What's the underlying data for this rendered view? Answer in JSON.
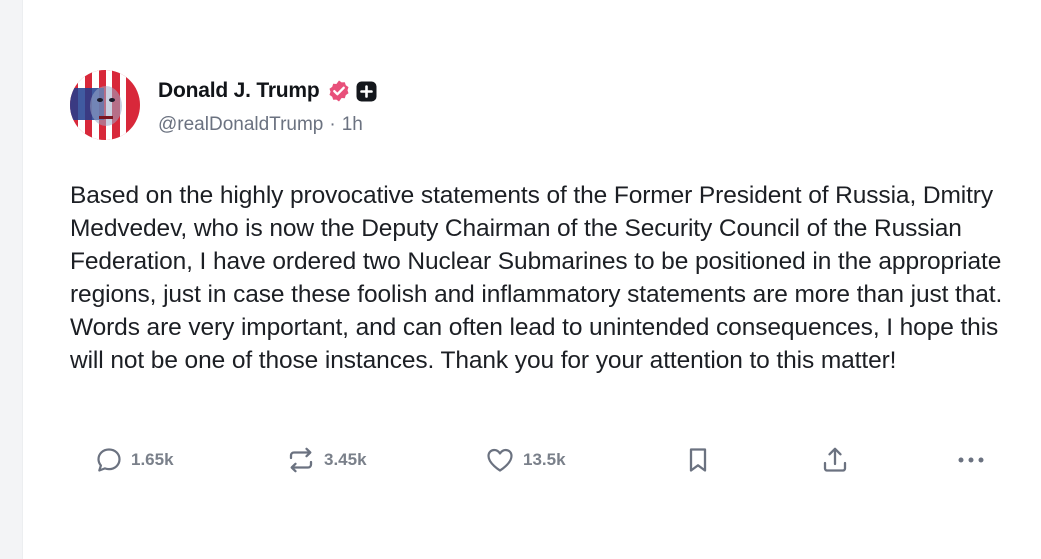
{
  "post": {
    "author": {
      "display_name": "Donald J. Trump",
      "handle": "@realDonaldTrump",
      "separator": "·",
      "time_ago": "1h",
      "verified_color": "#e8507a"
    },
    "body": "Based on the highly provocative statements of the Former President of Russia, Dmitry Medvedev, who is now the Deputy Chairman of the Security Council of the Russian Federation, I have ordered two Nuclear Submarines to be positioned in the appropriate regions, just in case these foolish and inflammatory statements are more than just that. Words are very important, and can often lead to unintended consequences, I hope this will not be one of those instances. Thank you for your attention to this matter!",
    "actions": {
      "replies": {
        "icon": "reply-icon",
        "count": "1.65k"
      },
      "reposts": {
        "icon": "repost-icon",
        "count": "3.45k"
      },
      "likes": {
        "icon": "heart-icon",
        "count": "13.5k"
      },
      "bookmark": {
        "icon": "bookmark-icon"
      },
      "share": {
        "icon": "share-icon"
      },
      "more": {
        "icon": "more-icon"
      }
    }
  }
}
